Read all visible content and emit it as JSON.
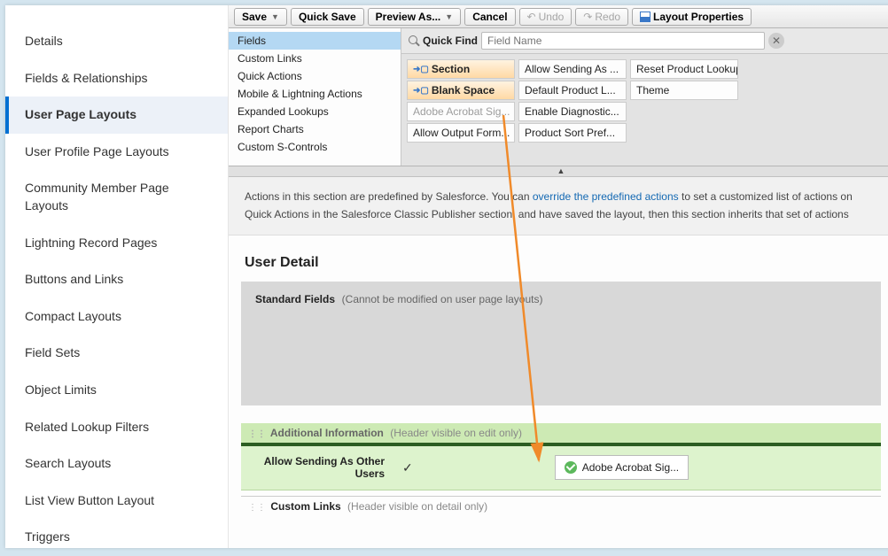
{
  "sidebar": {
    "items": [
      {
        "label": "Details"
      },
      {
        "label": "Fields & Relationships"
      },
      {
        "label": "User Page Layouts",
        "active": true
      },
      {
        "label": "User Profile Page Layouts"
      },
      {
        "label": "Community Member Page Layouts"
      },
      {
        "label": "Lightning Record Pages"
      },
      {
        "label": "Buttons and Links"
      },
      {
        "label": "Compact Layouts"
      },
      {
        "label": "Field Sets"
      },
      {
        "label": "Object Limits"
      },
      {
        "label": "Related Lookup Filters"
      },
      {
        "label": "Search Layouts"
      },
      {
        "label": "List View Button Layout"
      },
      {
        "label": "Triggers"
      }
    ]
  },
  "toolbar": {
    "save": "Save",
    "quick_save": "Quick Save",
    "preview_as": "Preview As...",
    "cancel": "Cancel",
    "undo": "Undo",
    "redo": "Redo",
    "layout_properties": "Layout Properties"
  },
  "palette": {
    "categories": [
      "Fields",
      "Custom Links",
      "Quick Actions",
      "Mobile & Lightning Actions",
      "Expanded Lookups",
      "Report Charts",
      "Custom S-Controls"
    ],
    "selected_category": "Fields",
    "quickfind_label": "Quick Find",
    "quickfind_placeholder": "Field Name",
    "items": [
      {
        "label": "Section",
        "highlight": true,
        "arrow": true
      },
      {
        "label": "Blank Space",
        "highlight": true,
        "arrow": true
      },
      {
        "label": "Adobe Acrobat Sig...",
        "dimmed": true
      },
      {
        "label": "Allow Output Form..."
      },
      {
        "label": "Allow Sending As ..."
      },
      {
        "label": "Default Product L..."
      },
      {
        "label": "Enable Diagnostic..."
      },
      {
        "label": "Product Sort Pref..."
      },
      {
        "label": "Reset Product Lookup"
      },
      {
        "label": "Theme"
      }
    ]
  },
  "notice": {
    "line1_pre": "Actions in this section are predefined by Salesforce. You can ",
    "line1_link": "override the predefined actions",
    "line1_post": " to set a customized list of actions on",
    "line2": "Quick Actions in the Salesforce Classic Publisher section, and have saved the layout, then this section inherits that set of actions"
  },
  "canvas": {
    "section_title": "User Detail",
    "standard_fields": {
      "header": "Standard Fields",
      "note": "(Cannot be modified on user page layouts)"
    },
    "additional": {
      "header": "Additional Information",
      "sub": "(Header visible on edit only)",
      "field_label": "Allow Sending As Other Users",
      "drop_target_label": "Adobe Acrobat Sig..."
    },
    "custom_links": {
      "header": "Custom Links",
      "sub": "(Header visible on detail only)"
    }
  }
}
